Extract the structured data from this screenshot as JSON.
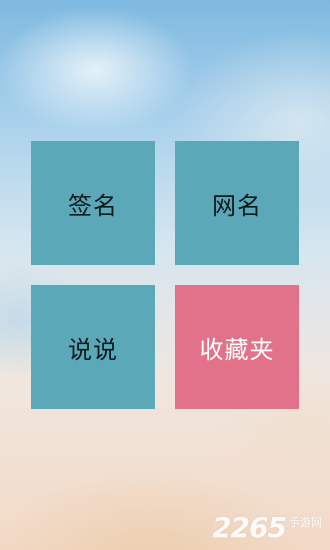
{
  "tiles": [
    {
      "label": "签名",
      "bg": "#5ba8b8",
      "fg": "#0e1a1e"
    },
    {
      "label": "网名",
      "bg": "#5ba8b8",
      "fg": "#0e1a1e"
    },
    {
      "label": "说说",
      "bg": "#5ba8b8",
      "fg": "#0e1a1e"
    },
    {
      "label": "收藏夹",
      "bg": "#e2728a",
      "fg": "#ffffff"
    }
  ],
  "watermark": {
    "number": "2265",
    "site": "手游网"
  }
}
